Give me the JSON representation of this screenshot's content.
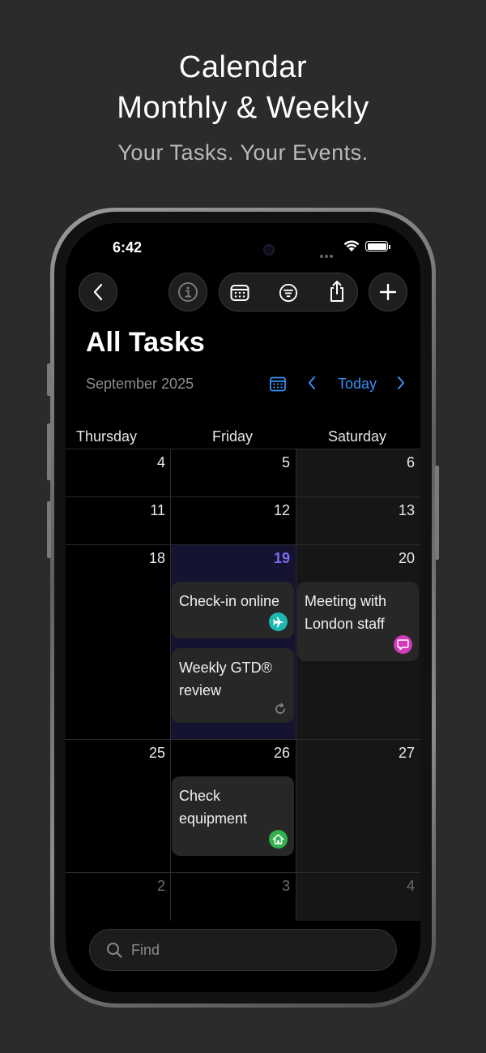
{
  "promo": {
    "title_line1": "Calendar",
    "title_line2": "Monthly & Weekly",
    "subtitle": "Your Tasks. Your Events."
  },
  "status_bar": {
    "time": "6:42"
  },
  "toolbar": {
    "back_icon": "chevron-left-icon",
    "info_icon": "info-icon",
    "calendar_view_icon": "calendar-grid-icon",
    "filter_icon": "filter-lines-icon",
    "share_icon": "share-icon",
    "add_icon": "plus-icon"
  },
  "header": {
    "title": "All Tasks",
    "month": "September 2025",
    "today_label": "Today"
  },
  "columns": [
    "Thursday",
    "Friday",
    "Saturday"
  ],
  "weeks": [
    [
      "4",
      "5",
      "6"
    ],
    [
      "11",
      "12",
      "13"
    ],
    [
      "18",
      "19",
      "20"
    ],
    [
      "25",
      "26",
      "27"
    ],
    [
      "2",
      "3",
      "4"
    ]
  ],
  "events": [
    {
      "title": "Check-in online",
      "icon": "airplane-icon",
      "color": "#1bb8b0"
    },
    {
      "title": "Weekly GTD® review",
      "icon": "repeat-icon",
      "color": "#8a8a8a"
    },
    {
      "title": "Meeting with London staff",
      "icon": "chat-bubble-icon",
      "color": "#d13bb6"
    },
    {
      "title": "Check equipment",
      "icon": "home-icon",
      "color": "#2fb14d"
    }
  ],
  "search": {
    "placeholder": "Find"
  },
  "colors": {
    "accent": "#3a8ef6",
    "today": "#7a6bf2",
    "background": "#000000"
  }
}
